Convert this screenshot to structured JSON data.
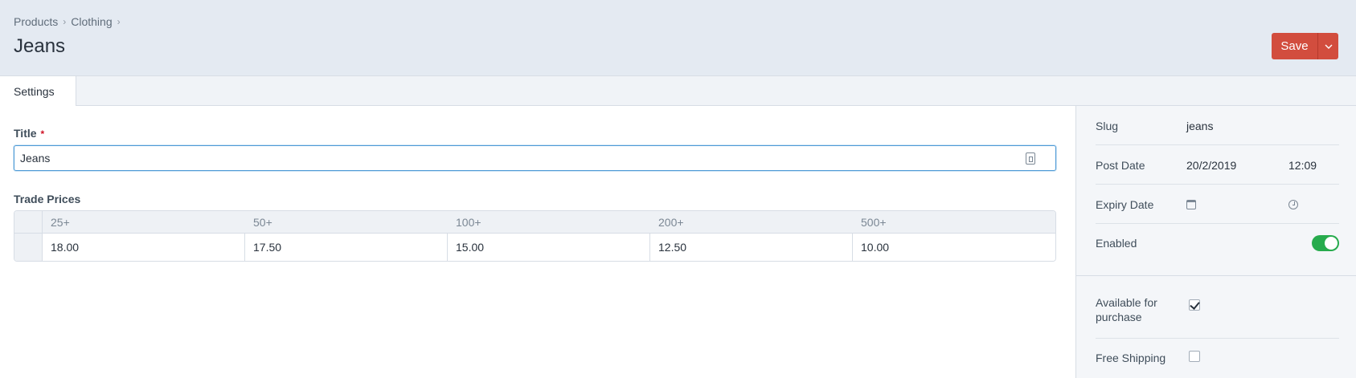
{
  "breadcrumb": {
    "items": [
      "Products",
      "Clothing"
    ],
    "separator": "›"
  },
  "page": {
    "title": "Jeans"
  },
  "actions": {
    "save_label": "Save"
  },
  "tabs": [
    {
      "label": "Settings",
      "active": true
    }
  ],
  "fields": {
    "title": {
      "label": "Title",
      "required_mark": "*",
      "value": "Jeans"
    },
    "trade_prices": {
      "label": "Trade Prices",
      "columns": [
        "25+",
        "50+",
        "100+",
        "200+",
        "500+"
      ],
      "rows": [
        [
          "18.00",
          "17.50",
          "15.00",
          "12.50",
          "10.00"
        ]
      ]
    }
  },
  "sidebar": {
    "slug": {
      "label": "Slug",
      "value": "jeans"
    },
    "post_date": {
      "label": "Post Date",
      "date": "20/2/2019",
      "time": "12:09"
    },
    "expiry_date": {
      "label": "Expiry Date"
    },
    "enabled": {
      "label": "Enabled",
      "on": true
    },
    "available": {
      "label": "Available for purchase",
      "checked": true
    },
    "free_shipping": {
      "label": "Free Shipping",
      "checked": false
    }
  },
  "colors": {
    "accent": "#d24d3e",
    "focus": "#4d9ad6",
    "toggle_on": "#27ab4d"
  }
}
